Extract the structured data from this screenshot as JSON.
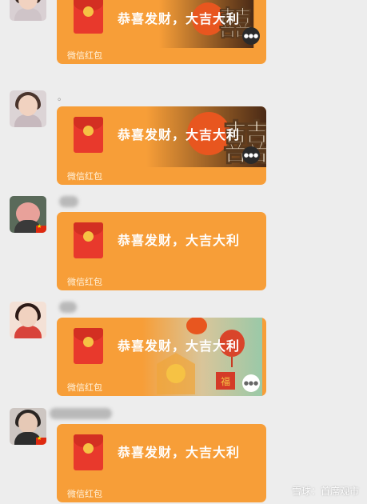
{
  "messages": [
    {
      "greeting": "恭喜发财，大吉大利",
      "footer_label": "微信红包",
      "cover": "calligraphy"
    },
    {
      "sender": "。",
      "greeting": "恭喜发财，大吉大利",
      "footer_label": "微信红包",
      "cover": "calligraphy"
    },
    {
      "greeting": "恭喜发财，大吉大利",
      "footer_label": "微信红包",
      "cover": "plain"
    },
    {
      "greeting": "恭喜发财，大吉大利",
      "footer_label": "微信红包",
      "cover": "lantern"
    },
    {
      "greeting": "恭喜发财，大吉大利",
      "footer_label": "微信红包",
      "cover": "plain"
    }
  ],
  "watermark": "雪球：首席观市",
  "colors": {
    "background": "#ededed",
    "packet": "#f79e38",
    "envelope": "#e8392c",
    "seal": "#f6c244"
  },
  "icons": [
    "red-packet-envelope-icon",
    "china-flag-icon",
    "mini-program-badge-icon"
  ]
}
